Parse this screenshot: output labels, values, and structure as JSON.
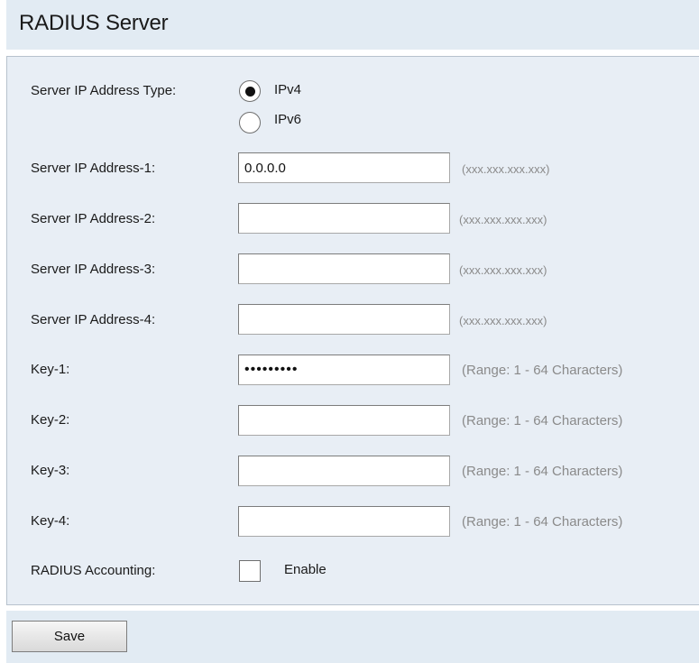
{
  "page": {
    "title": "RADIUS Server"
  },
  "ip_type": {
    "label": "Server IP Address Type:",
    "options": [
      {
        "label": "IPv4",
        "selected": true
      },
      {
        "label": "IPv6",
        "selected": false
      }
    ]
  },
  "servers": [
    {
      "label": "Server IP Address-1:",
      "value": "0.0.0.0",
      "hint": "(xxx.xxx.xxx.xxx)"
    },
    {
      "label": "Server IP Address-2:",
      "value": "",
      "hint": "(xxx.xxx.xxx.xxx)"
    },
    {
      "label": "Server IP Address-3:",
      "value": "",
      "hint": "(xxx.xxx.xxx.xxx)"
    },
    {
      "label": "Server IP Address-4:",
      "value": "",
      "hint": "(xxx.xxx.xxx.xxx)"
    }
  ],
  "keys": [
    {
      "label": "Key-1:",
      "value": "123456789",
      "hint": "(Range: 1 - 64 Characters)"
    },
    {
      "label": "Key-2:",
      "value": "",
      "hint": "(Range: 1 - 64 Characters)"
    },
    {
      "label": "Key-3:",
      "value": "",
      "hint": "(Range: 1 - 64 Characters)"
    },
    {
      "label": "Key-4:",
      "value": "",
      "hint": "(Range: 1 - 64 Characters)"
    }
  ],
  "accounting": {
    "label": "RADIUS Accounting:",
    "checkbox_label": "Enable",
    "checked": false
  },
  "actions": {
    "save_label": "Save"
  }
}
